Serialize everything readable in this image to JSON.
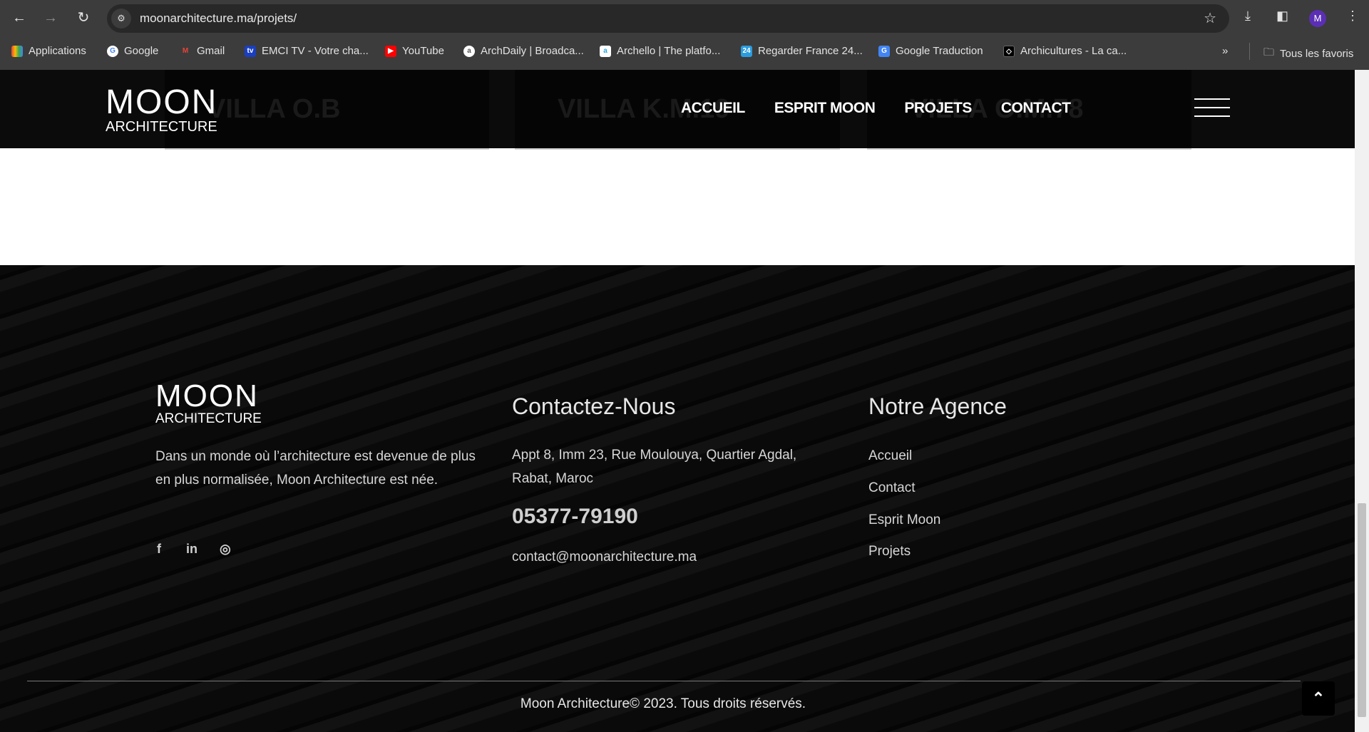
{
  "browser": {
    "url": "moonarchitecture.ma/projets/",
    "profile_initial": "M",
    "bookmarks": [
      "Applications",
      "Google",
      "Gmail",
      "EMCI TV - Votre cha...",
      "YouTube",
      "ArchDaily | Broadca...",
      "Archello | The platfo...",
      "Regarder France 24...",
      "Google Traduction",
      "Archicultures - La ca..."
    ],
    "all_bookmarks": "Tous les favoris",
    "more": "»"
  },
  "header": {
    "logo_top": "MOON",
    "logo_bottom": "ARCHITECTURE",
    "nav": [
      "ACCUEIL",
      "ESPRIT MOON",
      "PROJETS",
      "CONTACT"
    ]
  },
  "projects": [
    "VILLA O.B",
    "VILLA K.M.19",
    "VILLA O.M.78"
  ],
  "footer": {
    "logo_top": "MOON",
    "logo_bottom": "ARCHITECTURE",
    "description": "Dans un monde où l’architecture est devenue de plus en plus normalisée, Moon Architecture est née.",
    "social": [
      "facebook",
      "linkedin",
      "instagram"
    ],
    "contact": {
      "title": "Contactez-Nous",
      "address_line1": "Appt 8, Imm 23, Rue Moulouya, Quartier Agdal,",
      "address_line2": "Rabat, Maroc",
      "phone": "05377-79190",
      "email": "contact@moonarchitecture.ma"
    },
    "agency": {
      "title": "Notre Agence",
      "links": [
        "Accueil",
        "Contact",
        "Esprit Moon",
        "Projets"
      ]
    },
    "copyright": "Moon Architecture© 2023. Tous droits réservés."
  }
}
